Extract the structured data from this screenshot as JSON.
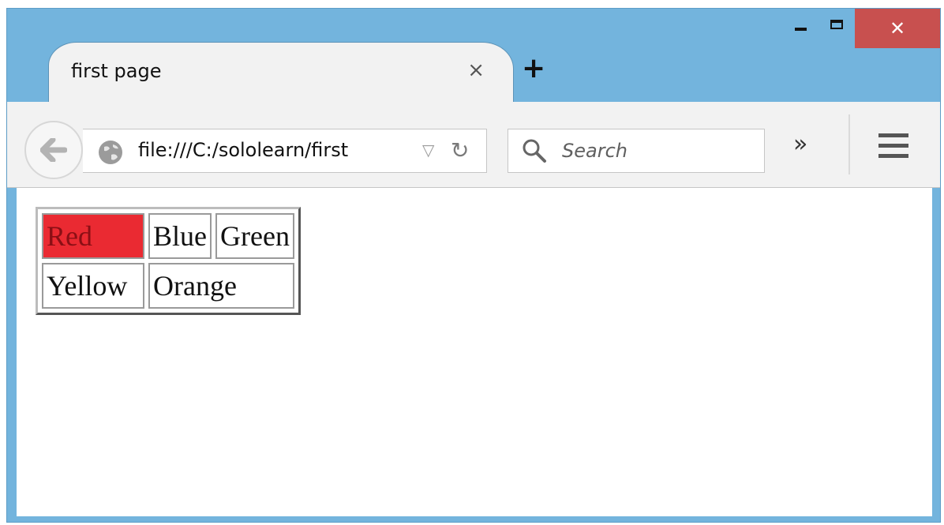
{
  "window": {
    "controls": {
      "minimize": "minimize",
      "maximize": "maximize",
      "close": "close"
    }
  },
  "tab": {
    "title": "first page",
    "close_glyph": "×",
    "new_tab_glyph": "+"
  },
  "toolbar": {
    "url": "file:///C:/sololearn/first",
    "search_placeholder": "Search",
    "overflow_glyph": "»",
    "reload_glyph": "↻",
    "dropdown_glyph": "▽"
  },
  "table": {
    "rows": [
      [
        "Red",
        "Blue",
        "Green"
      ],
      [
        "Yellow",
        "Orange"
      ]
    ],
    "highlight_color": "#ea2a32"
  },
  "colors": {
    "titlebar": "#73b4dd",
    "close_button": "#c8504f",
    "toolbar": "#f2f2f2"
  }
}
